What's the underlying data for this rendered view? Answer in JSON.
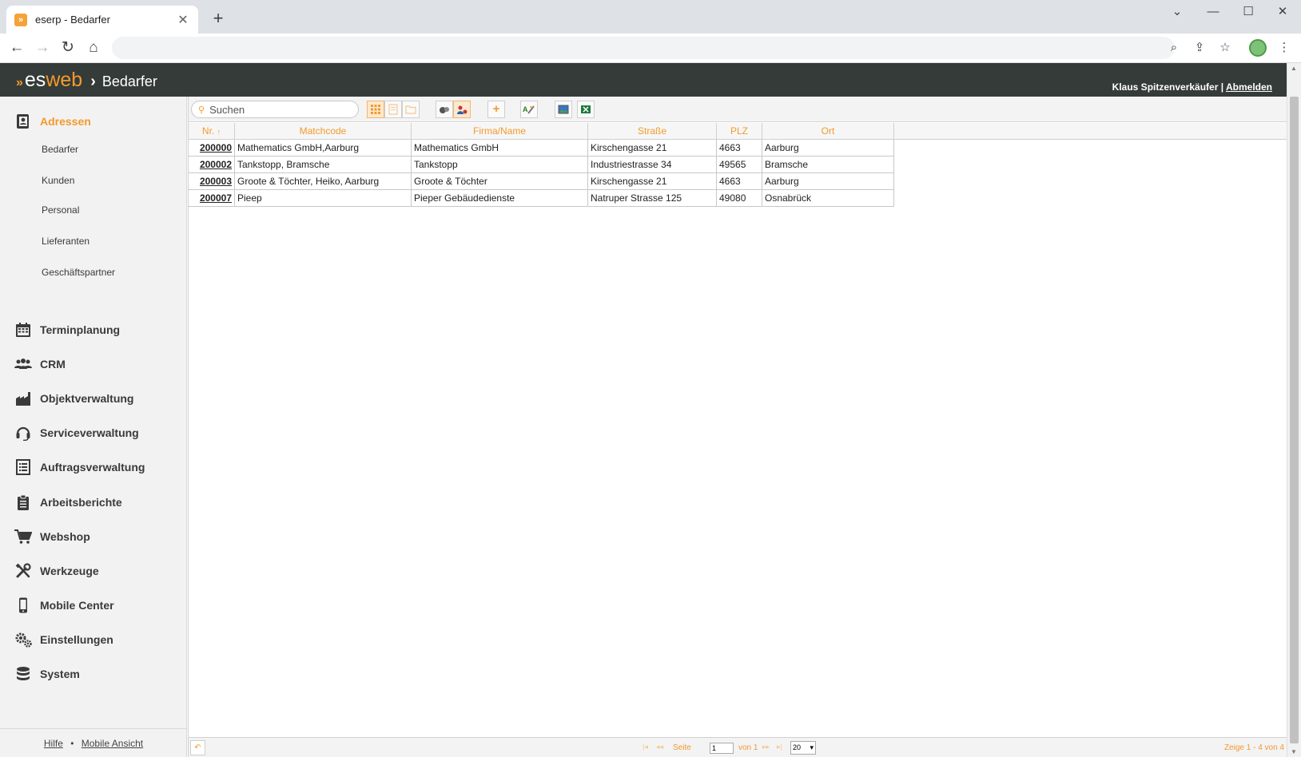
{
  "browser": {
    "tab_title": "eserp - Bedarfer",
    "tab_close": "✕",
    "new_tab": "+",
    "favicon": "»"
  },
  "header": {
    "logo_arrow": "»",
    "logo_es": "es",
    "logo_web": "web",
    "crumb_sep": "›",
    "page_title": "Bedarfer",
    "user_name": "Klaus Spitzenverkäufer",
    "user_sep": " | ",
    "logout": "Abmelden"
  },
  "sidebar": {
    "active": {
      "label": "Adressen",
      "icon": "address-book-icon"
    },
    "subitems": [
      "Bedarfer",
      "Kunden",
      "Personal",
      "Lieferanten",
      "Geschäftspartner"
    ],
    "items": [
      {
        "label": "Terminplanung",
        "icon": "calendar-icon"
      },
      {
        "label": "CRM",
        "icon": "users-icon"
      },
      {
        "label": "Objektverwaltung",
        "icon": "factory-icon"
      },
      {
        "label": "Serviceverwaltung",
        "icon": "headset-icon"
      },
      {
        "label": "Auftragsverwaltung",
        "icon": "list-icon"
      },
      {
        "label": "Arbeitsberichte",
        "icon": "clipboard-icon"
      },
      {
        "label": "Webshop",
        "icon": "cart-icon"
      },
      {
        "label": "Werkzeuge",
        "icon": "tools-icon"
      },
      {
        "label": "Mobile Center",
        "icon": "mobile-icon"
      },
      {
        "label": "Einstellungen",
        "icon": "gears-icon"
      },
      {
        "label": "System",
        "icon": "database-icon"
      }
    ],
    "footer": {
      "help": "Hilfe",
      "sep": "•",
      "mobile": "Mobile Ansicht"
    }
  },
  "search": {
    "placeholder": "Suchen"
  },
  "grid": {
    "columns": [
      "Nr.",
      "Matchcode",
      "Firma/Name",
      "Straße",
      "PLZ",
      "Ort"
    ],
    "sort_indicator": "↑",
    "rows": [
      {
        "nr": "200000",
        "matchcode": "Mathematics GmbH,Aarburg",
        "firma": "Mathematics GmbH",
        "strasse": "Kirschengasse 21",
        "plz": "4663",
        "ort": "Aarburg"
      },
      {
        "nr": "200002",
        "matchcode": "Tankstopp, Bramsche",
        "firma": "Tankstopp",
        "strasse": "Industriestrasse 34",
        "plz": "49565",
        "ort": "Bramsche"
      },
      {
        "nr": "200003",
        "matchcode": "Groote & Töchter, Heiko, Aarburg",
        "firma": "Groote & Töchter",
        "strasse": "Kirschengasse 21",
        "plz": "4663",
        "ort": "Aarburg"
      },
      {
        "nr": "200007",
        "matchcode": "Pieep",
        "firma": "Pieper Gebäudedienste",
        "strasse": "Natruper Strasse 125",
        "plz": "49080",
        "ort": "Osnabrück"
      }
    ]
  },
  "pager": {
    "page_label": "Seite",
    "page_value": "1",
    "of_label": "von 1",
    "page_size": "20",
    "info": "Zeige 1 - 4 von 4"
  },
  "colors": {
    "accent": "#f29a2e",
    "header_bg": "#353b38",
    "sidebar_bg": "#f2f2f2"
  }
}
